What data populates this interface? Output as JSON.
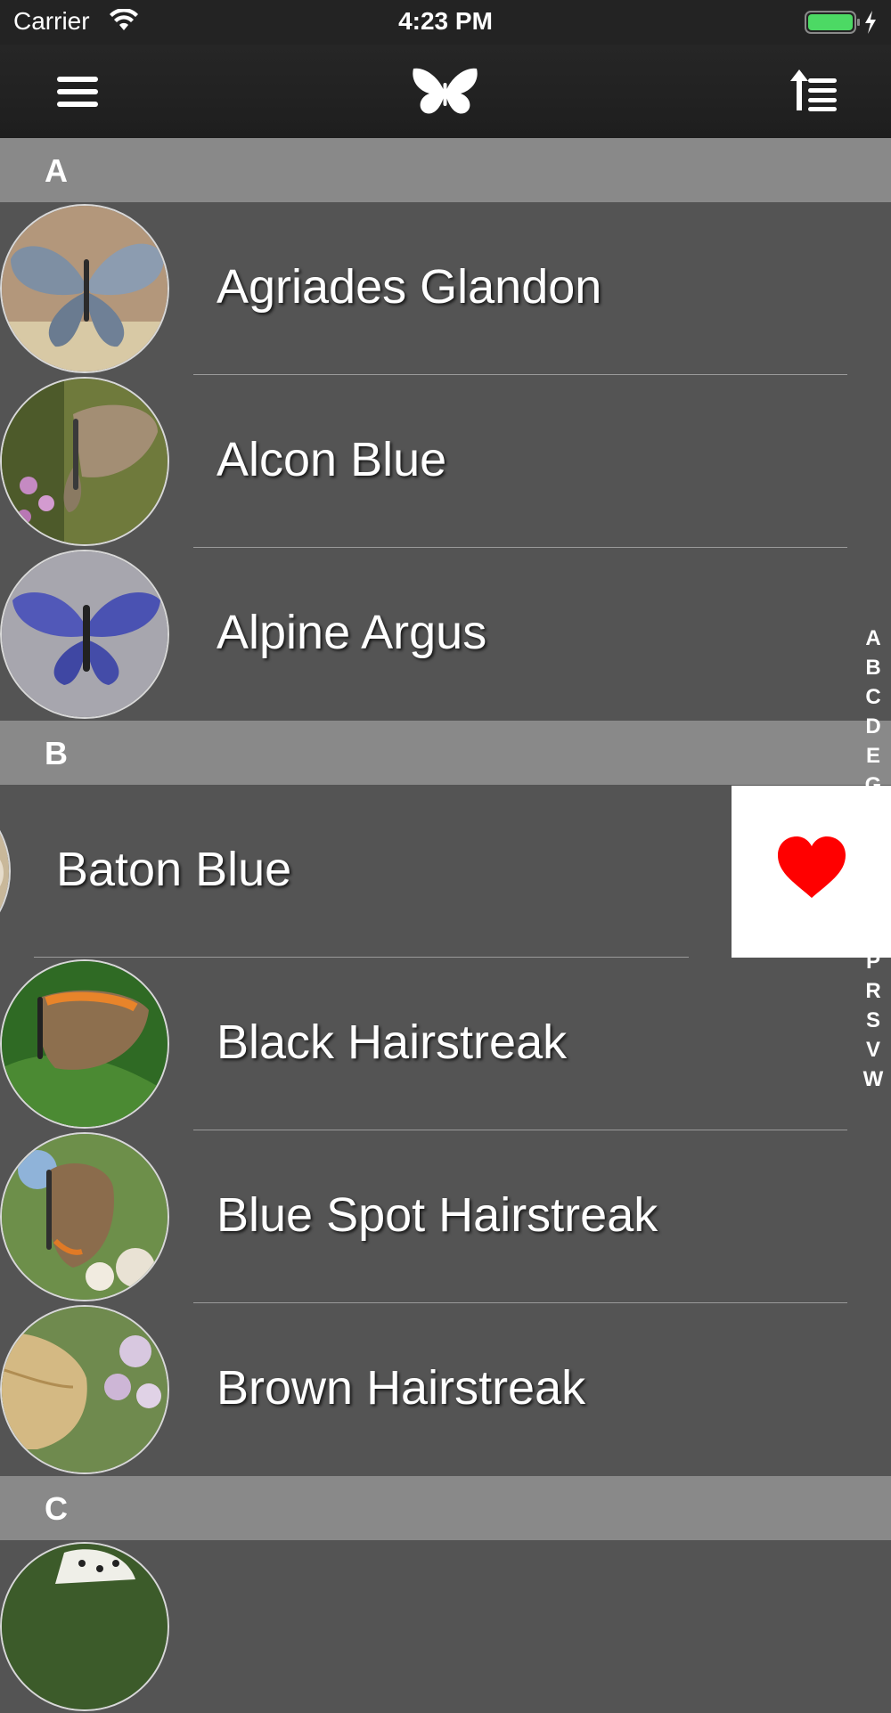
{
  "status_bar": {
    "carrier": "Carrier",
    "time": "4:23 PM",
    "battery_color": "#4cd964"
  },
  "nav_bar": {
    "menu_icon": "hamburger-menu-icon",
    "logo_icon": "butterfly-icon",
    "sort_icon": "sort-ascending-icon"
  },
  "sections": [
    {
      "letter": "A",
      "items": [
        {
          "name": "Agriades Glandon",
          "thumb_color": "#7e8fa3"
        },
        {
          "name": "Alcon Blue",
          "thumb_color": "#8a7a62"
        },
        {
          "name": "Alpine Argus",
          "thumb_color": "#5158b8"
        }
      ]
    },
    {
      "letter": "B",
      "items": [
        {
          "name": "Baton Blue",
          "thumb_color": "#c9b89a"
        },
        {
          "name": "Black Hairstreak",
          "thumb_color": "#3e7b2e"
        },
        {
          "name": "Blue Spot Hairstreak",
          "thumb_color": "#8b6c4c"
        },
        {
          "name": "Brown Hairstreak",
          "thumb_color": "#b99c66"
        }
      ]
    },
    {
      "letter": "C",
      "items": []
    }
  ],
  "index_letters": [
    "A",
    "B",
    "C",
    "D",
    "E",
    "G",
    "P",
    "R",
    "S",
    "V",
    "W"
  ],
  "swipe_action": {
    "icon": "heart-icon",
    "color": "#ff0000"
  }
}
